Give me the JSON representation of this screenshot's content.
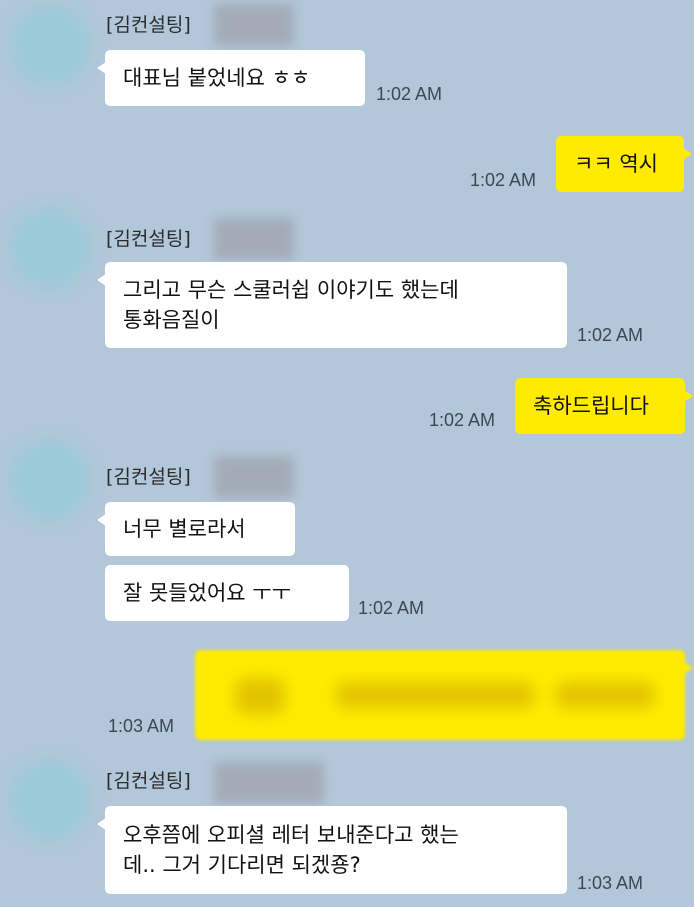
{
  "chat": {
    "sender_name": "[김컨설팅]",
    "messages": [
      {
        "direction": "in",
        "lines": [
          "대표님 붙었네요 ㅎㅎ"
        ],
        "time": "1:02 AM"
      },
      {
        "direction": "out",
        "lines": [
          "ㅋㅋ 역시"
        ],
        "time": "1:02 AM"
      },
      {
        "direction": "in",
        "lines": [
          "그리고 무슨 스쿨러쉽 이야기도 했는데",
          "통화음질이"
        ],
        "time": "1:02 AM"
      },
      {
        "direction": "out",
        "lines": [
          "축하드립니다"
        ],
        "time": "1:02 AM"
      },
      {
        "direction": "in",
        "lines": [
          "너무 별로라서"
        ],
        "time": ""
      },
      {
        "direction": "in",
        "lines": [
          "잘 못들었어요 ㅜㅜ"
        ],
        "time": "1:02 AM"
      },
      {
        "direction": "out",
        "lines": [],
        "time": "1:03 AM"
      },
      {
        "direction": "in",
        "lines": [
          "오후쯤에 오피셜 레터 보내준다고 했는",
          "데.. 그거 기다리면 되겠죵?"
        ],
        "time": "1:03 AM"
      }
    ]
  },
  "colors": {
    "background": "#b2c7d9",
    "incoming_bubble": "#ffffff",
    "outgoing_bubble": "#ffeb00"
  }
}
